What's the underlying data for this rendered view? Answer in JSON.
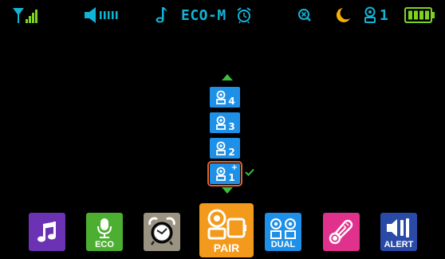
{
  "status": {
    "eco_mode": "ECO-M",
    "camera_number": "1",
    "colors": {
      "accent": "#12b4d6",
      "battery": "#7ed321"
    },
    "icons": [
      "signal-icon",
      "volume-icon",
      "music-note-icon",
      "alarm-clock-icon",
      "zoom-icon",
      "night-mode-icon",
      "camera-icon",
      "battery-icon"
    ]
  },
  "camera_list": {
    "items": [
      {
        "number": "4",
        "selected": false
      },
      {
        "number": "3",
        "selected": false
      },
      {
        "number": "2",
        "selected": false
      },
      {
        "number": "1",
        "selected": true,
        "added": "+"
      }
    ],
    "colors": {
      "button": "#1e90e8",
      "selection": "#e4602a",
      "arrow": "#3dbb3d",
      "check": "#3dbb3d"
    }
  },
  "dock": {
    "items": [
      {
        "id": "music",
        "label": "",
        "color": "#6b32b4",
        "icon": "music-icon"
      },
      {
        "id": "eco",
        "label": "ECO",
        "color": "#4caf32",
        "icon": "microphone-icon"
      },
      {
        "id": "alarm",
        "label": "",
        "color": "#9b9382",
        "icon": "alarm-clock-icon"
      },
      {
        "id": "pair",
        "label": "PAIR",
        "color": "#f39a1c",
        "icon": "pair-camera-icon",
        "active": true
      },
      {
        "id": "dual",
        "label": "DUAL",
        "color": "#1e90e8",
        "icon": "dual-camera-icon"
      },
      {
        "id": "temperature",
        "label": "",
        "color": "#e0328c",
        "icon": "thermometer-icon"
      },
      {
        "id": "alert",
        "label": "ALERT",
        "color": "#2a4aa8",
        "icon": "speaker-alert-icon"
      }
    ]
  }
}
